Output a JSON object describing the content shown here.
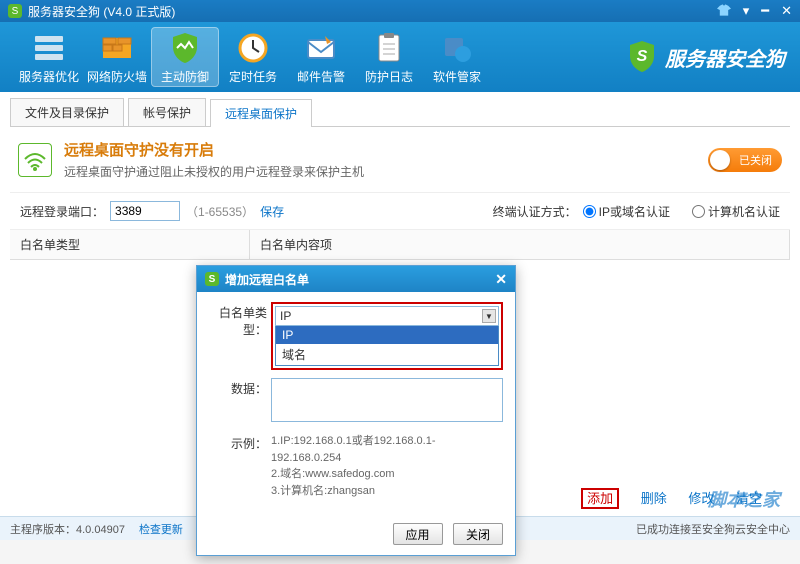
{
  "title": "服务器安全狗 (V4.0 正式版)",
  "toolbar": {
    "items": [
      {
        "label": "服务器优化"
      },
      {
        "label": "网络防火墙"
      },
      {
        "label": "主动防御"
      },
      {
        "label": "定时任务"
      },
      {
        "label": "邮件告警"
      },
      {
        "label": "防护日志"
      },
      {
        "label": "软件管家"
      }
    ],
    "brand": "服务器安全狗"
  },
  "tabs": [
    {
      "label": "文件及目录保护"
    },
    {
      "label": "帐号保护"
    },
    {
      "label": "远程桌面保护"
    }
  ],
  "status": {
    "title": "远程桌面守护没有开启",
    "desc": "远程桌面守护通过阻止未授权的用户远程登录来保护主机",
    "toggle_label": "已关闭"
  },
  "port": {
    "label": "远程登录端口：",
    "value": "3389",
    "range": "（1-65535）",
    "save": "保存",
    "auth_label": "终端认证方式：",
    "opt_ip": "IP或域名认证",
    "opt_host": "计算机名认证"
  },
  "list_header": {
    "type": "白名单类型",
    "content": "白名单内容项"
  },
  "actions": {
    "add": "添加",
    "delete": "删除",
    "edit": "修改",
    "clear": "清空"
  },
  "footer": {
    "version": "主程序版本：4.0.04907",
    "update": "检查更新",
    "status": "已成功连接至安全狗云安全中心"
  },
  "watermark": "脚本之家",
  "dialog": {
    "title": "增加远程白名单",
    "type_label": "白名单类型：",
    "type_value": "IP",
    "options": [
      "IP",
      "域名"
    ],
    "data_label": "数据：",
    "example_label": "示例：",
    "examples": [
      "1.IP:192.168.0.1或者192.168.0.1-192.168.0.254",
      "2.域名:www.safedog.com",
      "3.计算机名:zhangsan"
    ],
    "apply": "应用",
    "close": "关闭"
  }
}
